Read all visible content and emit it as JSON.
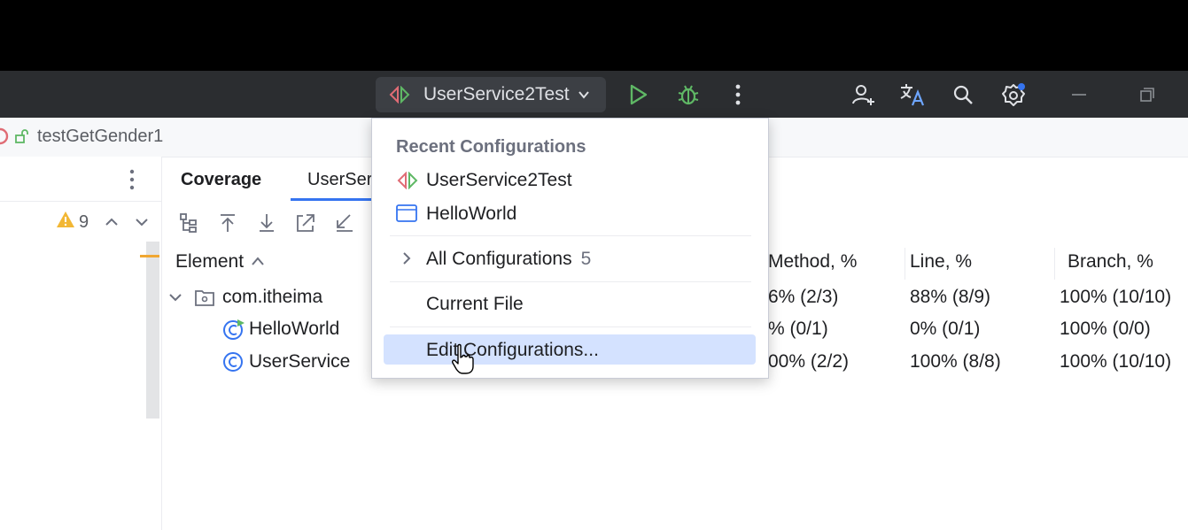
{
  "titlebar": {
    "run_config_name": "UserService2Test",
    "icons": [
      "run-config-icon",
      "chevron-down-icon",
      "run-icon",
      "debug-icon",
      "more-icon",
      "add-user-icon",
      "translate-icon",
      "search-icon",
      "settings-icon",
      "minimize-icon",
      "restore-icon"
    ]
  },
  "breadcrumb": {
    "text": "testGetGender1"
  },
  "left_panel": {
    "warning_count": "9"
  },
  "tabs": [
    {
      "label": "Coverage"
    },
    {
      "label": "UserSer"
    }
  ],
  "coverage_table": {
    "columns": [
      "Element",
      "Method, %",
      "Line, %",
      "Branch, %"
    ],
    "rows": [
      {
        "element": "com.itheima",
        "method": "6% (2/3)",
        "line": "88% (8/9)",
        "branch": "100% (10/10)"
      },
      {
        "element": "HelloWorld",
        "method": "% (0/1)",
        "line": "0% (0/1)",
        "branch": "100% (0/0)"
      },
      {
        "element": "UserService",
        "method": "00% (2/2)",
        "line": "100% (8/8)",
        "branch": "100% (10/10)"
      }
    ]
  },
  "popup": {
    "header": "Recent Configurations",
    "recent": [
      "UserService2Test",
      "HelloWorld"
    ],
    "all_configurations_label": "All Configurations",
    "all_configurations_count": "5",
    "current_file_label": "Current File",
    "edit_configurations_label": "Edit Configurations..."
  },
  "colors": {
    "accent": "#3574f0",
    "run_green": "#5fb865",
    "highlight": "#d4e2ff",
    "warning": "#f2b735"
  }
}
